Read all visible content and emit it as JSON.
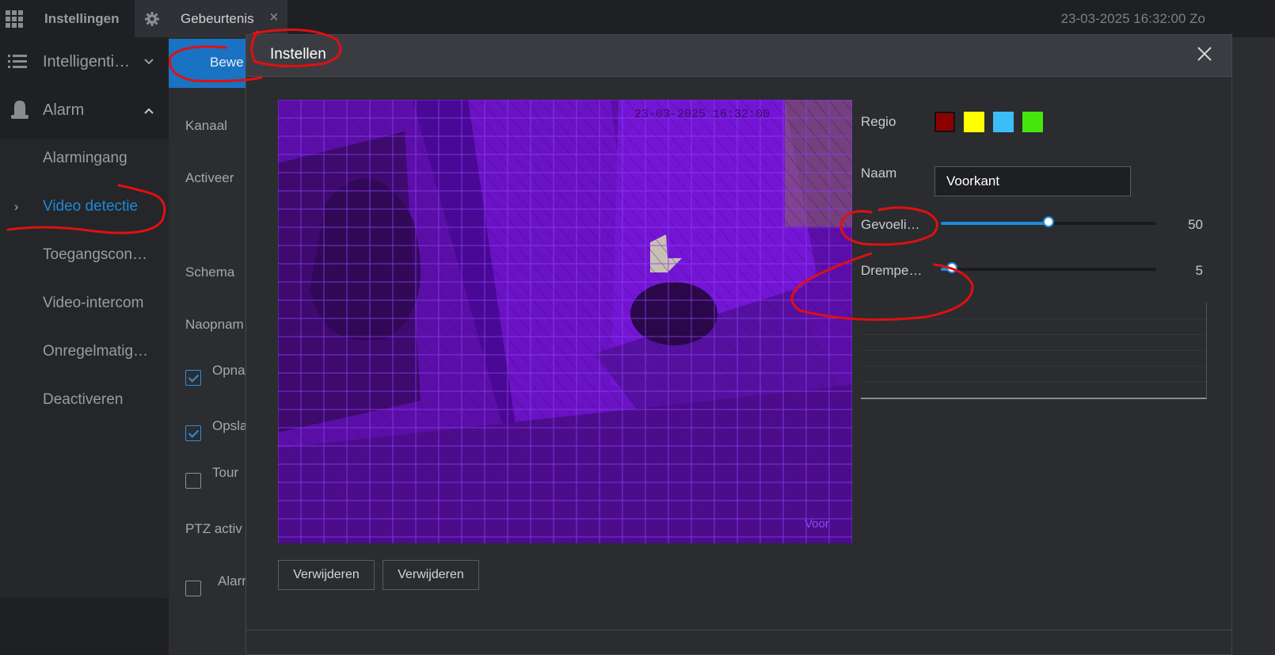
{
  "topbar": {
    "app_title": "Instellingen",
    "tab_label": "Gebeurtenis",
    "tab_close": "×",
    "datetime": "23-03-2025 16:32:00 Zo"
  },
  "sidebar": {
    "section_intelligent": "Intelligenti…",
    "section_alarm": "Alarm",
    "items": [
      {
        "label": "Alarmingang"
      },
      {
        "label": "Video detectie"
      },
      {
        "label": "Toegangscon…"
      },
      {
        "label": "Video-intercom"
      },
      {
        "label": "Onregelmatig…"
      },
      {
        "label": "Deactiveren"
      }
    ],
    "active_arrow": "›"
  },
  "background_form": {
    "tab_button": "Bewe",
    "kanaal": "Kanaal",
    "activeer": "Activeer",
    "schema": "Schema",
    "naopname": "Naopnam",
    "opname": "Opna",
    "opslag": "Opsla",
    "tour": "Tour",
    "ptz": "PTZ activ",
    "alarm": "Alarr"
  },
  "modal": {
    "title": "Instellen",
    "regio_label": "Regio",
    "region_colors": [
      "#8b0000",
      "#ffff00",
      "#3dbdf5",
      "#44e60d"
    ],
    "naam_label": "Naam",
    "naam_value": "Voorkant",
    "gevoeligheid_label": "Gevoeli…",
    "gevoeligheid_value": "50",
    "gevoeligheid_level": 50,
    "drempel_label": "Drempe…",
    "drempel_value": "5",
    "drempel_level": 5,
    "delete_button_1": "Verwijderen",
    "delete_button_2": "Verwijderen"
  },
  "video": {
    "timestamp": "23-03-2025 16:32:00",
    "camera_name": "Voor"
  },
  "colors": {
    "accent": "#1e8ad6",
    "annotation": "#e01010",
    "mask": "#6a00d0"
  }
}
